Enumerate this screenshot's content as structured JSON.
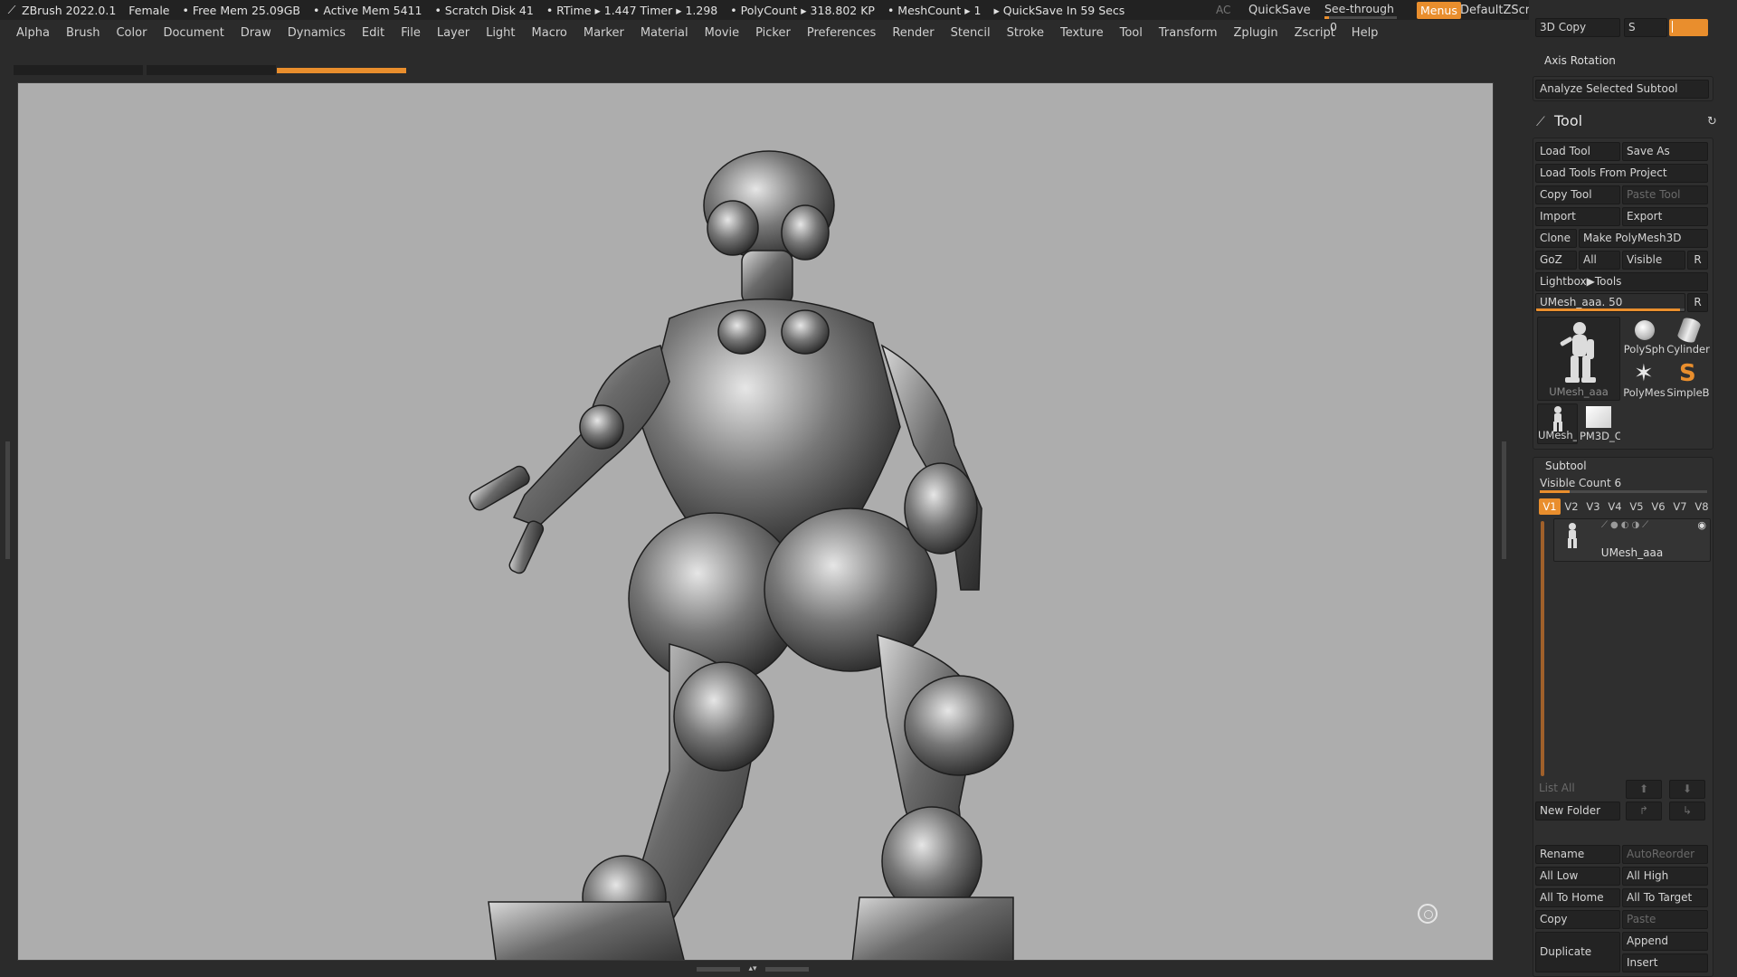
{
  "titlebar": {
    "app": "ZBrush 2022.0.1",
    "project": "Female",
    "free_mem": "• Free Mem 25.09GB",
    "active_mem": "• Active Mem 5411",
    "scratch": "• Scratch Disk 41",
    "rtime": "• RTime ▸ 1.447 Timer ▸ 1.298",
    "polycount": "• PolyCount ▸ 318.802 KP",
    "meshcount": "• MeshCount ▸ 1",
    "quicksave_in": "▸ QuickSave In 59 Secs",
    "ac": "AC",
    "quicksave": "QuickSave",
    "see_through_label": "See-through",
    "see_through_value": "0",
    "see_through_level": 0.06,
    "menus": "Menus",
    "default_zscript": "DefaultZScript"
  },
  "menubar": [
    "Alpha",
    "Brush",
    "Color",
    "Document",
    "Draw",
    "Dynamics",
    "Edit",
    "File",
    "Layer",
    "Light",
    "Macro",
    "Marker",
    "Material",
    "Movie",
    "Picker",
    "Preferences",
    "Render",
    "Stencil",
    "Stroke",
    "Texture",
    "Tool",
    "Transform",
    "Zplugin",
    "Zscript",
    "Help"
  ],
  "accent": "#e98e2d",
  "panel": {
    "top": {
      "copy3d": "3D Copy",
      "copy3d_key": "S",
      "axis_rotation": "Axis Rotation",
      "analyze": "Analyze Selected Subtool"
    },
    "tool": {
      "title": "Tool",
      "load_tool": "Load Tool",
      "save_as": "Save As",
      "load_from_project": "Load Tools From Project",
      "copy_tool": "Copy Tool",
      "paste_tool": "Paste Tool",
      "import": "Import",
      "export": "Export",
      "clone": "Clone",
      "make_polymesh": "Make PolyMesh3D",
      "goz": "GoZ",
      "all": "All",
      "visible": "Visible",
      "r": "R",
      "lightbox": "Lightbox▶Tools",
      "umesh_slider": "UMesh_aaa. 50",
      "umesh_slider_level": 0.96,
      "r2": "R",
      "thumbs": {
        "main": "UMesh_aaa",
        "polysphere": "PolySph",
        "cylinder": "Cylinder",
        "polymesh": "PolyMes",
        "simpleb": "SimpleB",
        "umesh_small": "UMesh_",
        "pm3d": "PM3D_C"
      }
    },
    "subtool": {
      "title": "Subtool",
      "visible_count": "Visible Count 6",
      "visible_count_level": 0.18,
      "vtabs": [
        "V1",
        "V2",
        "V3",
        "V4",
        "V5",
        "V6",
        "V7",
        "V8"
      ],
      "row_name": "UMesh_aaa",
      "list_all": "List All",
      "new_folder": "New Folder",
      "rename": "Rename",
      "auto_reorder": "AutoReorder",
      "all_low": "All Low",
      "all_high": "All High",
      "all_to_home": "All To Home",
      "all_to_target": "All To Target",
      "copy": "Copy",
      "paste": "Paste",
      "duplicate": "Duplicate",
      "append": "Append",
      "insert": "Insert"
    }
  },
  "icons": [
    "zbrush-logo-icon",
    "brush-icon",
    "refresh-icon",
    "navigation-ring-icon",
    "sphere-icon",
    "cylinder-icon",
    "star-icon",
    "snake-icon",
    "arrow-up-icon",
    "arrow-down-icon",
    "eye-icon"
  ]
}
